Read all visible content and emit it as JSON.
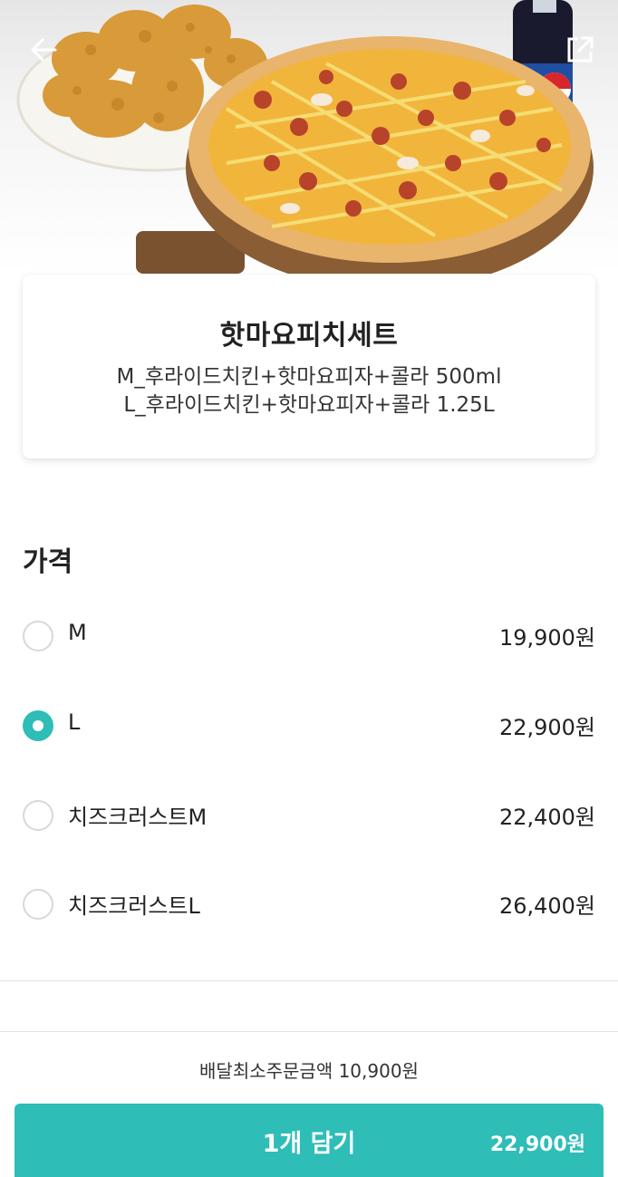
{
  "product": {
    "name": "핫마요피치세트",
    "description_lines": [
      "M_후라이드치킨+핫마요피자+콜라 500ml",
      "L_후라이드치킨+핫마요피자+콜라 1.25L"
    ]
  },
  "price_section": {
    "title": "가격",
    "options": [
      {
        "label": "M",
        "price": "19,900원",
        "selected": false
      },
      {
        "label": "L",
        "price": "22,900원",
        "selected": true
      },
      {
        "label": "치즈크러스트M",
        "price": "22,400원",
        "selected": false
      },
      {
        "label": "치즈크러스트L",
        "price": "26,400원",
        "selected": false
      }
    ]
  },
  "footer": {
    "min_order": "배달최소주문금액 10,900원",
    "cart_label": "1개 담기",
    "cart_price": "22,900원"
  },
  "icons": {
    "back": "arrow-left-icon",
    "share": "share-icon"
  },
  "colors": {
    "accent": "#2ebdb7"
  }
}
